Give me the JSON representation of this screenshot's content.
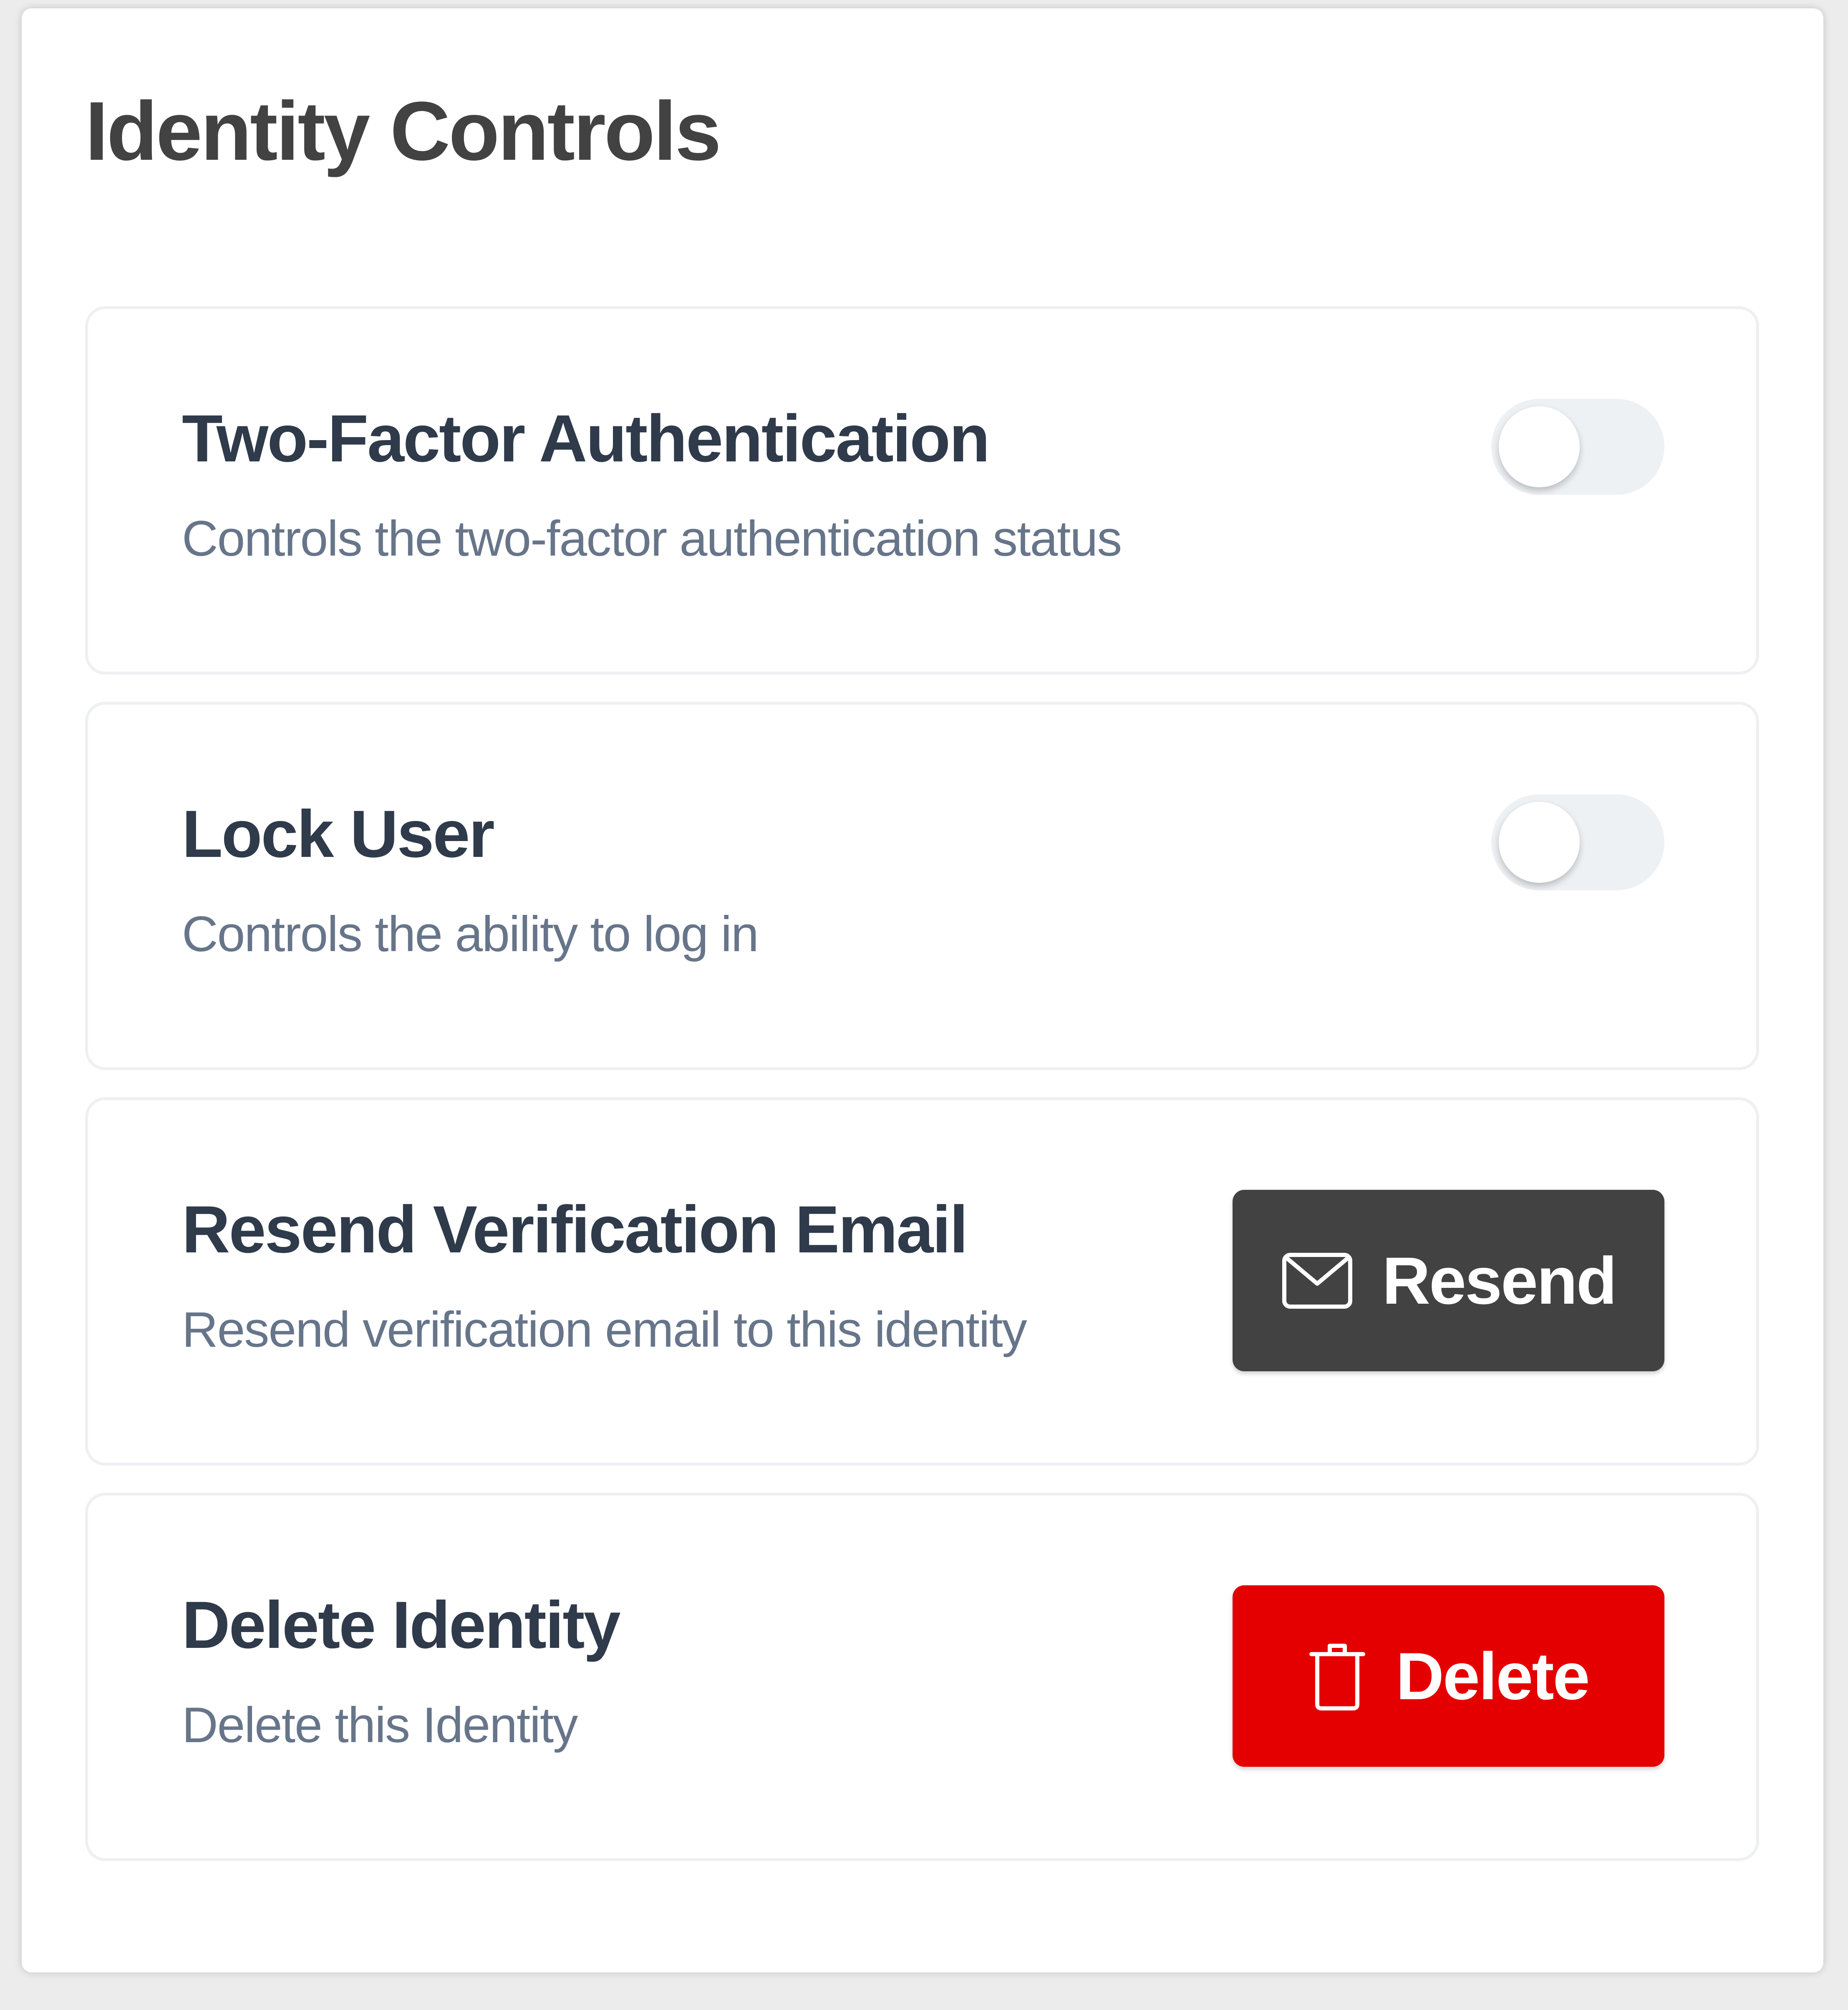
{
  "panel": {
    "title": "Identity Controls"
  },
  "controls": {
    "two_factor": {
      "title": "Two-Factor Authentication",
      "description": "Controls the two-factor authentication status",
      "enabled": false
    },
    "lock_user": {
      "title": "Lock User",
      "description": "Controls the ability to log in",
      "enabled": false
    },
    "resend_verification": {
      "title": "Resend Verification Email",
      "description": "Resend verification email to this identity",
      "button_label": "Resend",
      "button_icon": "envelope-icon",
      "button_color": "#424242"
    },
    "delete_identity": {
      "title": "Delete Identity",
      "description": "Delete this Identity",
      "button_label": "Delete",
      "button_icon": "trash-icon",
      "button_color": "#e50000"
    }
  },
  "colors": {
    "page_background": "#ececec",
    "panel_background": "#ffffff",
    "title_text": "#424242",
    "card_title_text": "#2f3a4a",
    "description_text": "#67758a",
    "toggle_track_off": "#eef1f4",
    "card_border": "#eef0f2"
  }
}
